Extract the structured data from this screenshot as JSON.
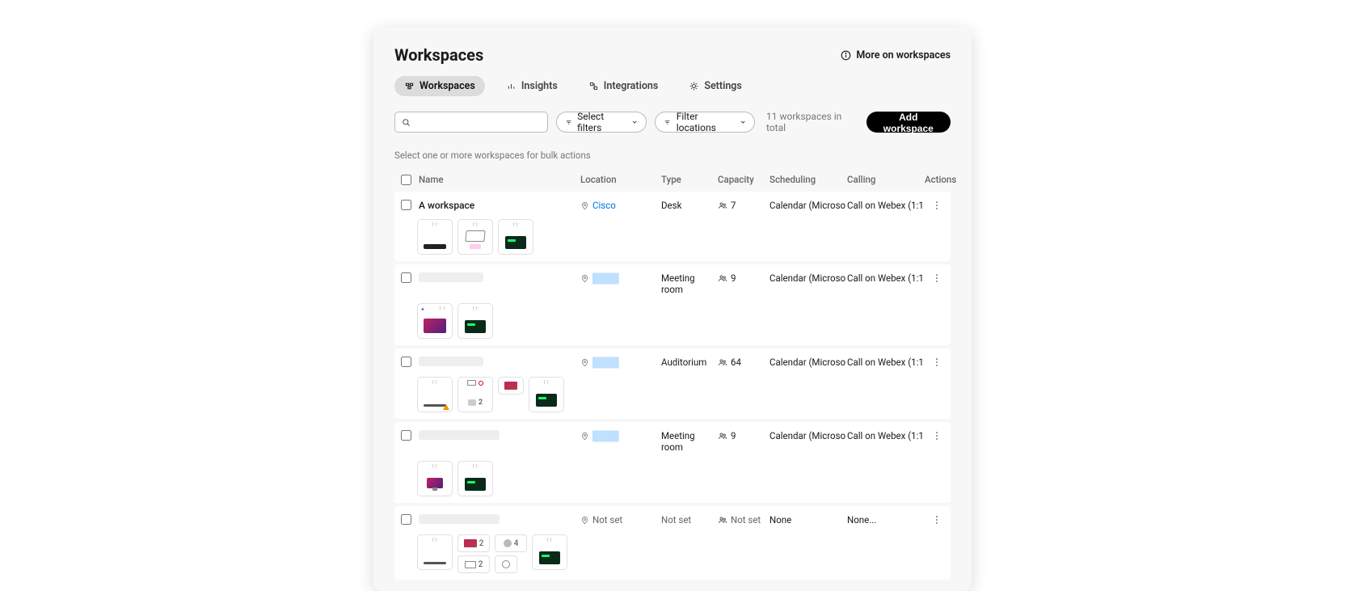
{
  "header": {
    "title": "Workspaces",
    "more_label": "More on workspaces"
  },
  "tabs": [
    {
      "label": "Workspaces",
      "active": true,
      "icon": "workspaces-icon"
    },
    {
      "label": "Insights",
      "active": false,
      "icon": "insights-icon"
    },
    {
      "label": "Integrations",
      "active": false,
      "icon": "integrations-icon"
    },
    {
      "label": "Settings",
      "active": false,
      "icon": "settings-icon"
    }
  ],
  "filters": {
    "search_placeholder": "",
    "select_filters": "Select filters",
    "filter_locations": "Filter locations",
    "total_text": "11 workspaces in total",
    "add_workspace": "Add workspace"
  },
  "bulk_text": "Select one or more workspaces for bulk actions",
  "columns": {
    "name": "Name",
    "location": "Location",
    "type": "Type",
    "capacity": "Capacity",
    "scheduling": "Scheduling",
    "calling": "Calling",
    "actions": "Actions"
  },
  "rows": [
    {
      "name": "A workspace",
      "location": "Cisco",
      "type": "Desk",
      "capacity": "7",
      "scheduling": "Calendar (Microsoft)",
      "calling": "Call on Webex (1:1...",
      "name_blur": false,
      "loc_blur": false,
      "not_set": false,
      "devices": "set1"
    },
    {
      "name": "",
      "location": "",
      "type": "Meeting room",
      "capacity": "9",
      "scheduling": "Calendar (Microsoft)",
      "calling": "Call on Webex (1:1...",
      "name_blur": true,
      "loc_blur": true,
      "not_set": false,
      "devices": "set2"
    },
    {
      "name": "",
      "location": "",
      "type": "Auditorium",
      "capacity": "64",
      "scheduling": "Calendar (Microsoft)",
      "calling": "Call on Webex (1:1...",
      "name_blur": true,
      "loc_blur": true,
      "not_set": false,
      "devices": "set3"
    },
    {
      "name": "",
      "location": "",
      "type": "Meeting room",
      "capacity": "9",
      "scheduling": "Calendar (Microsoft)",
      "calling": "Call on Webex (1:1...",
      "name_blur": true,
      "loc_blur": true,
      "not_set": false,
      "devices": "set4"
    },
    {
      "name": "",
      "location": "Not set",
      "type": "Not set",
      "capacity": "Not set",
      "scheduling": "None",
      "calling": "None...",
      "name_blur": true,
      "loc_blur": false,
      "not_set": true,
      "devices": "set5"
    }
  ],
  "device_counts": {
    "set3_a": "2",
    "set5_a": "2",
    "set5_b": "4",
    "set5_c": "2"
  }
}
